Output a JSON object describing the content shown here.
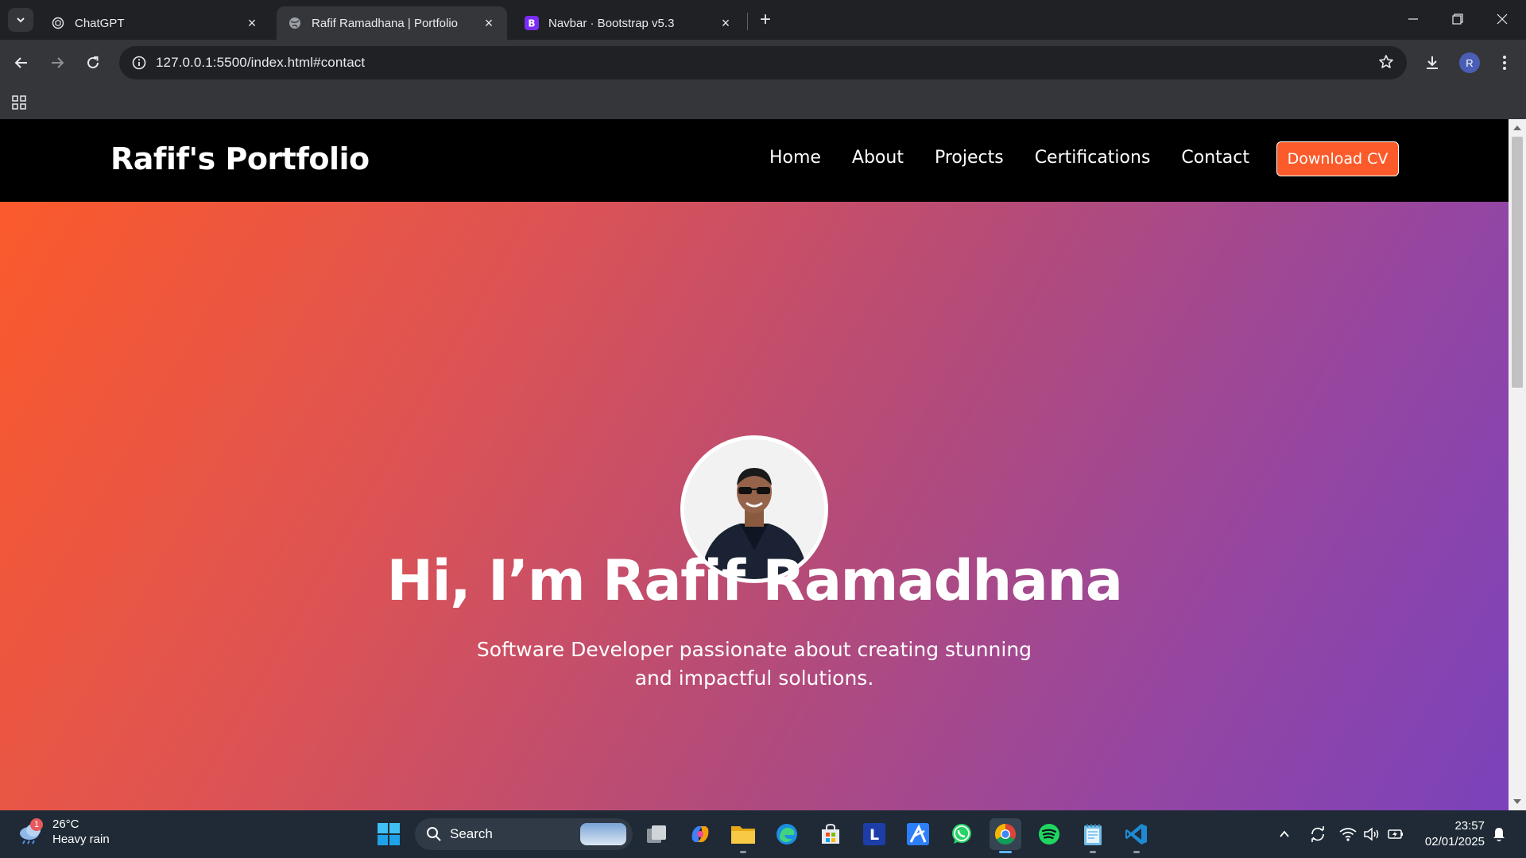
{
  "browser": {
    "tabs": [
      {
        "title": "ChatGPT",
        "active": false
      },
      {
        "title": "Rafif Ramadhana | Portfolio",
        "active": true
      },
      {
        "title": "Navbar · Bootstrap v5.3",
        "active": false
      }
    ],
    "url": "127.0.0.1:5500/index.html#contact",
    "profile_initial": "R"
  },
  "site": {
    "brand": "Rafif's Portfolio",
    "nav": [
      "Home",
      "About",
      "Projects",
      "Certifications",
      "Contact"
    ],
    "cta": "Download CV",
    "hero": {
      "title": "Hi, I’m Rafif Ramadhana",
      "subtitle": "Software Developer passionate about creating stunning and impactful solutions."
    },
    "colors": {
      "accent": "#fb5b2a",
      "gradient_start": "#fb5a2b",
      "gradient_end": "#7b42bb",
      "navbar": "#000000"
    }
  },
  "taskbar": {
    "weather": {
      "temp": "26°C",
      "condition": "Heavy rain",
      "badge": "1"
    },
    "search_label": "Search",
    "apps": [
      "task-view",
      "copilot",
      "file-explorer",
      "edge",
      "microsoft-store",
      "l-app",
      "vector-app",
      "whatsapp",
      "chrome",
      "spotify",
      "notepad",
      "vscode"
    ],
    "time": "23:57",
    "date": "02/01/2025"
  }
}
